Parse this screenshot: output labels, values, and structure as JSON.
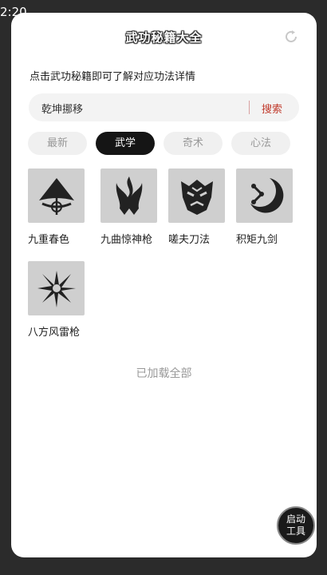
{
  "status": {
    "time": "2:20"
  },
  "header": {
    "title": "武功秘籍大全",
    "refresh_icon": "refresh-icon"
  },
  "subtitle": "点击武功秘籍即可了解对应功法详情",
  "search": {
    "value": "乾坤挪移",
    "button": "搜索"
  },
  "tabs": [
    {
      "label": "最新",
      "active": false
    },
    {
      "label": "武学",
      "active": true
    },
    {
      "label": "奇术",
      "active": false
    },
    {
      "label": "心法",
      "active": false
    }
  ],
  "items": [
    {
      "label": "九重春色",
      "icon": "umbrella-emblem-icon"
    },
    {
      "label": "九曲惊神枪",
      "icon": "flame-emblem-icon"
    },
    {
      "label": "嗟夫刀法",
      "icon": "tiger-emblem-icon"
    },
    {
      "label": "积矩九剑",
      "icon": "crescent-emblem-icon"
    },
    {
      "label": "八方风雷枪",
      "icon": "burst-emblem-icon"
    }
  ],
  "footer": "已加载全部",
  "fab": {
    "line1": "启动",
    "line2": "工具"
  }
}
